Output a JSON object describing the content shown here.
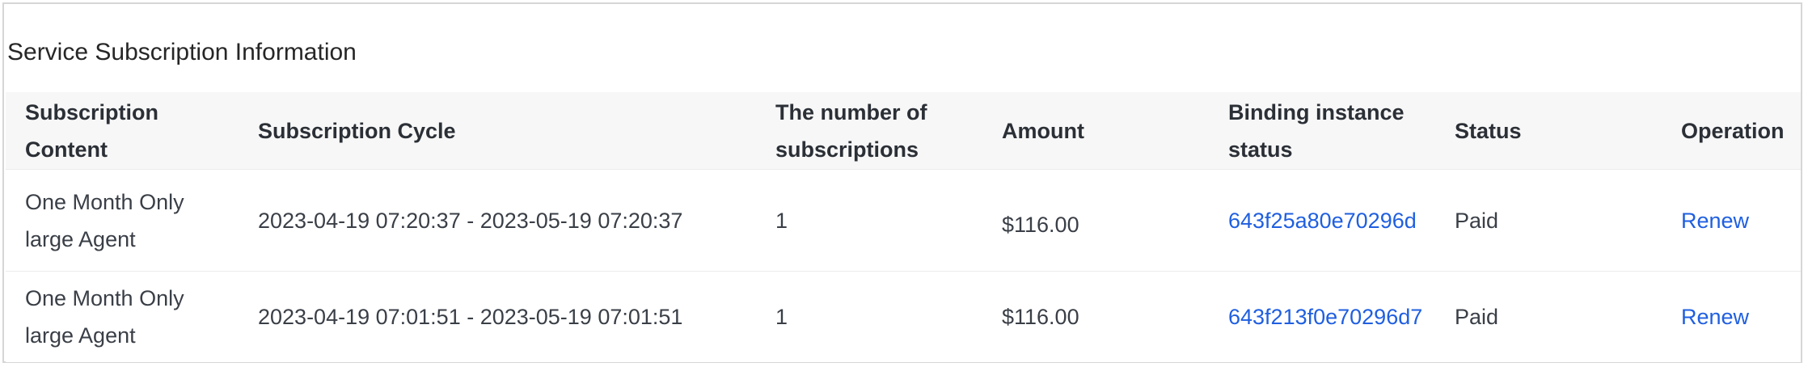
{
  "section": {
    "title": "Service Subscription Information"
  },
  "table": {
    "columns": [
      "Subscription Content",
      "Subscription Cycle",
      "The number of subscriptions",
      "Amount",
      "Binding instance status",
      "Status",
      "Operation"
    ],
    "rows": [
      {
        "content": "One Month Only large Agent",
        "cycle": "2023-04-19 07:20:37 - 2023-05-19 07:20:37",
        "count": "1",
        "amount": "$116.00",
        "instance": "643f25a80e70296d",
        "status": "Paid",
        "operation": "Renew"
      },
      {
        "content": "One Month Only large Agent",
        "cycle": "2023-04-19 07:01:51 - 2023-05-19 07:01:51",
        "count": "1",
        "amount": "$116.00",
        "instance": "643f213f0e70296d7",
        "status": "Paid",
        "operation": "Renew"
      }
    ]
  },
  "colors": {
    "link": "#1f5fe0",
    "header_bg": "#f7f7f7",
    "border": "#d6d6d6"
  }
}
